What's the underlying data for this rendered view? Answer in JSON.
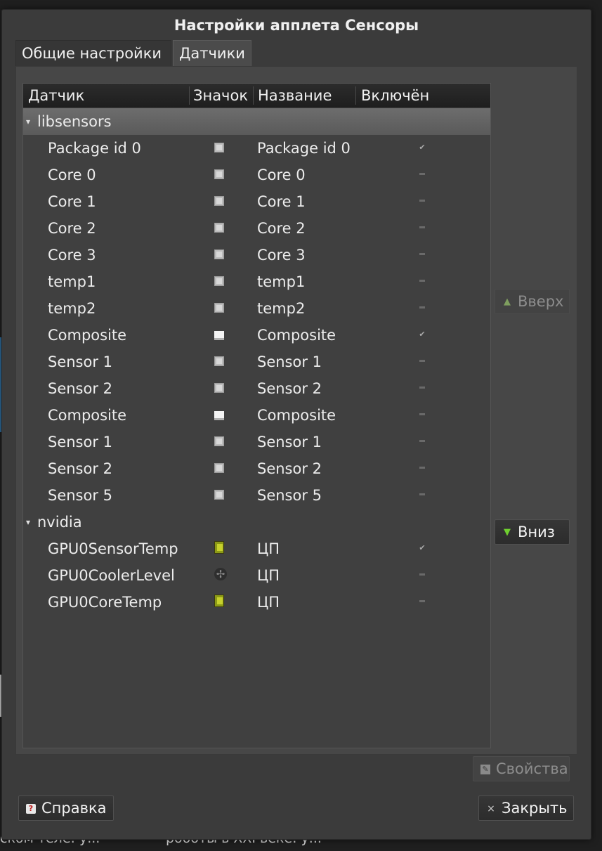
{
  "background": {
    "text_left": "ском теле: у...",
    "text_right": "роботы в XXI веке: у..."
  },
  "window": {
    "title": "Настройки апплета Сенсоры"
  },
  "tabs": [
    {
      "label": "Общие настройки",
      "active": false
    },
    {
      "label": "Датчики",
      "active": true
    }
  ],
  "table": {
    "columns": {
      "sensor": "Датчик",
      "icon": "Значок",
      "name": "Название",
      "enabled": "Включён"
    },
    "groups": [
      {
        "label": "libsensors",
        "expanded": true,
        "rows": [
          {
            "sensor": "Package id 0",
            "icon": "cpu-chip-icon",
            "name": "Package id 0",
            "enabled": true
          },
          {
            "sensor": "Core 0",
            "icon": "cpu-chip-icon",
            "name": "Core 0",
            "enabled": false
          },
          {
            "sensor": "Core 1",
            "icon": "cpu-chip-icon",
            "name": "Core 1",
            "enabled": false
          },
          {
            "sensor": "Core 2",
            "icon": "cpu-chip-icon",
            "name": "Core 2",
            "enabled": false
          },
          {
            "sensor": "Core 3",
            "icon": "cpu-chip-icon",
            "name": "Core 3",
            "enabled": false
          },
          {
            "sensor": "temp1",
            "icon": "cpu-chip-icon",
            "name": "temp1",
            "enabled": false
          },
          {
            "sensor": "temp2",
            "icon": "cpu-chip-icon",
            "name": "temp2",
            "enabled": false
          },
          {
            "sensor": "Composite",
            "icon": "hard-disk-icon",
            "name": "Composite",
            "enabled": true
          },
          {
            "sensor": "Sensor 1",
            "icon": "cpu-chip-icon",
            "name": "Sensor 1",
            "enabled": false
          },
          {
            "sensor": "Sensor 2",
            "icon": "cpu-chip-icon",
            "name": "Sensor 2",
            "enabled": false
          },
          {
            "sensor": "Composite",
            "icon": "hard-disk-icon",
            "name": "Composite",
            "enabled": false
          },
          {
            "sensor": "Sensor 1",
            "icon": "cpu-chip-icon",
            "name": "Sensor 1",
            "enabled": false
          },
          {
            "sensor": "Sensor 2",
            "icon": "cpu-chip-icon",
            "name": "Sensor 2",
            "enabled": false
          },
          {
            "sensor": "Sensor 5",
            "icon": "cpu-chip-icon",
            "name": "Sensor 5",
            "enabled": false
          }
        ]
      },
      {
        "label": "nvidia",
        "expanded": true,
        "rows": [
          {
            "sensor": "GPU0SensorTemp",
            "icon": "gpu-card-icon",
            "name": "ЦП",
            "enabled": true
          },
          {
            "sensor": "GPU0CoolerLevel",
            "icon": "fan-icon",
            "name": "ЦП",
            "enabled": false
          },
          {
            "sensor": "GPU0CoreTemp",
            "icon": "gpu-card-icon",
            "name": "ЦП",
            "enabled": false
          }
        ]
      }
    ]
  },
  "side_buttons": {
    "up": "Вверх",
    "down": "Вниз",
    "properties": "Свойства"
  },
  "footer": {
    "help": "Справка",
    "close": "Закрыть"
  }
}
